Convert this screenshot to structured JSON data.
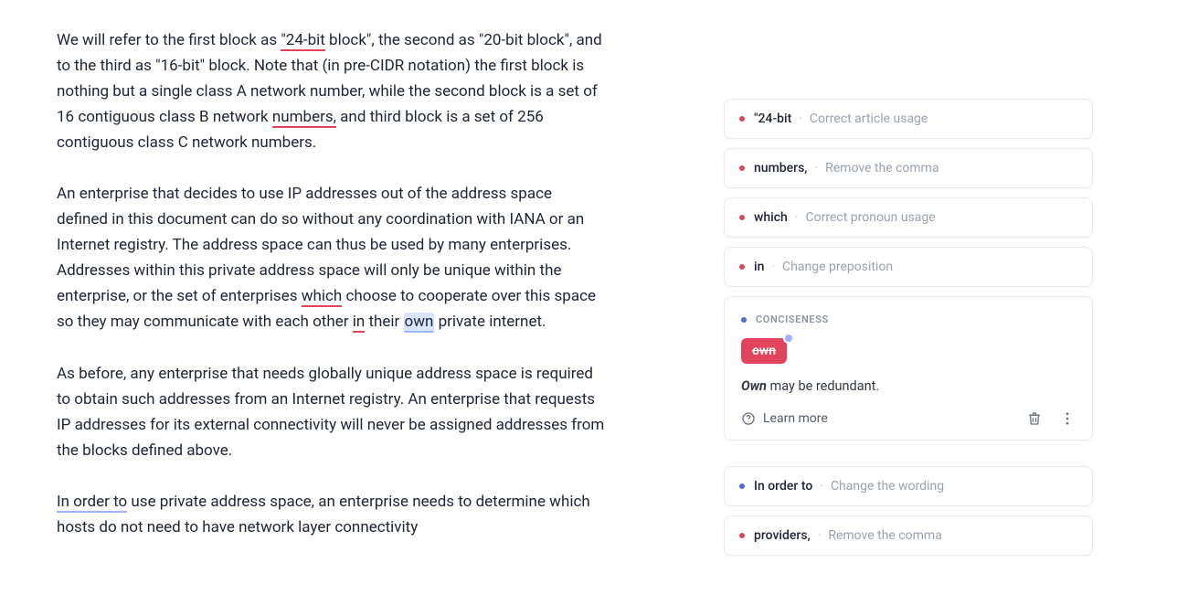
{
  "editor": {
    "paragraphs": [
      {
        "t0": "We will refer to the first block as ",
        "u0": "\"24-bit",
        "t1": " block\", the second as \"20-bit block\", and to the third as \"16-bit\" block. Note that (in pre-CIDR notation) the first block is nothing but a single class A network number, while the second block is a set of 16 contiguous class B network ",
        "u1": "numbers,",
        "t2": " and third block is a set of 256 contiguous class C network numbers."
      },
      {
        "t0": "An enterprise that decides to use IP addresses out of the address space defined in this document can do so without any coordination with IANA or an Internet registry. The address space can thus be used by many enterprises. Addresses within this private address space will only be unique within the enterprise, or the set of enterprises ",
        "u0": "which",
        "t1": " choose to cooperate over this space so they may communicate with each other ",
        "u1": "in",
        "t2": " their ",
        "u2": "own",
        "t3": " private internet."
      },
      {
        "t0": "As before, any enterprise that needs globally unique address space is required to obtain such addresses from an Internet registry. An enterprise that requests IP addresses for its external connectivity will never be assigned addresses from the blocks defined above."
      },
      {
        "u0": "In order to",
        "t0": " use private address space, an enterprise needs to determine which hosts do not need to have network layer connectivity"
      }
    ]
  },
  "suggestions": {
    "collapsed": [
      {
        "term": "\"24-bit",
        "hint": "Correct article usage"
      },
      {
        "term": "numbers,",
        "hint": "Remove the comma"
      },
      {
        "term": "which",
        "hint": "Correct pronoun usage"
      },
      {
        "term": "in",
        "hint": "Change preposition"
      }
    ],
    "expanded": {
      "category": "CONCISENESS",
      "chip": "own",
      "desc_bold": "Own",
      "desc_rest": " may be redundant.",
      "learn": "Learn more"
    },
    "collapsed_after": [
      {
        "term": "In order to",
        "hint": "Change the wording"
      },
      {
        "term": "providers,",
        "hint": "Remove the comma"
      }
    ]
  }
}
